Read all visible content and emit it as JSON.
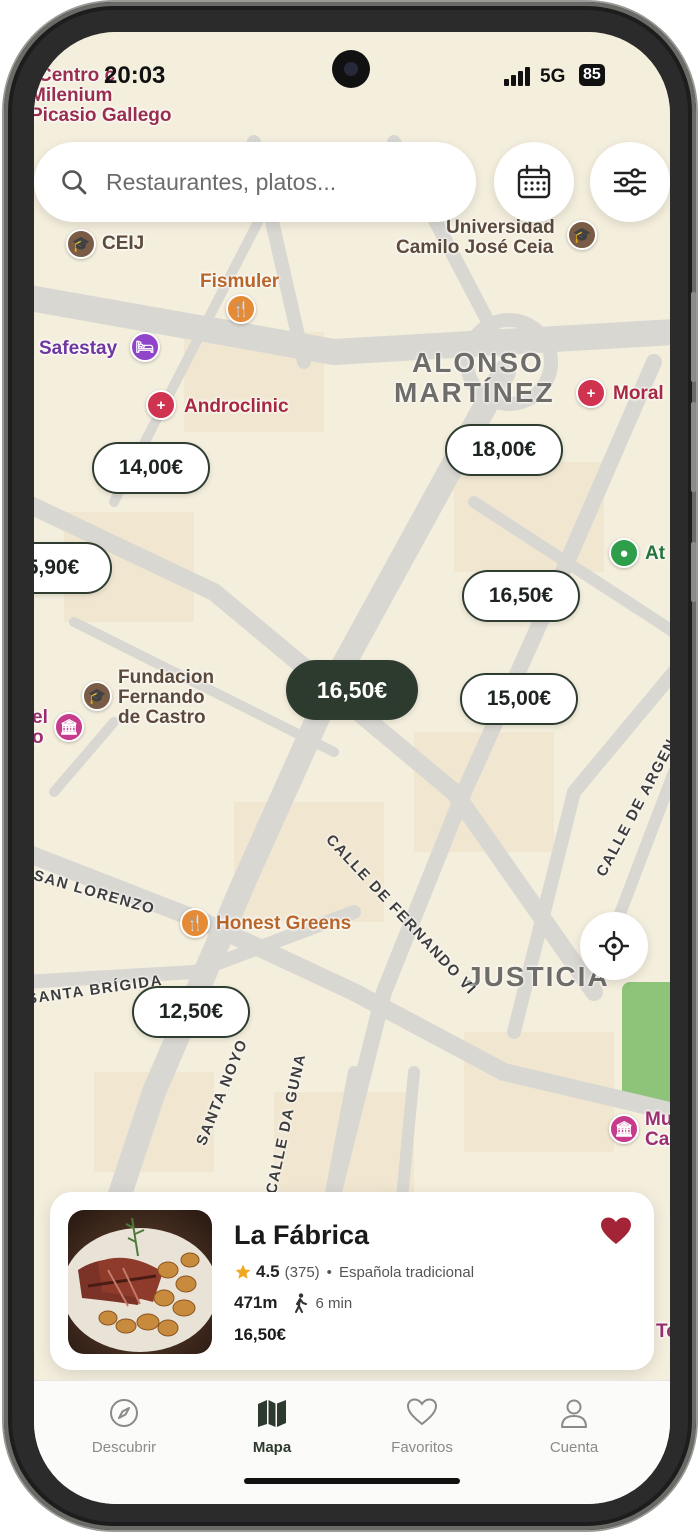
{
  "status_bar": {
    "time": "20:03",
    "network": "5G",
    "battery": "85"
  },
  "search": {
    "placeholder": "Restaurantes, platos..."
  },
  "map": {
    "districts": [
      "ALONSO",
      "MARTÍNEZ",
      "JUSTICIA"
    ],
    "streets": [
      "CALLE DE FERNANDO VI",
      "SAN LORENZO",
      "SANTA BRÍGIDA",
      "SANTA NOYO",
      "CALLE DA GUNA",
      "CALLE DE ARGEN"
    ],
    "pois": [
      {
        "label": "Centro c",
        "icon": "none"
      },
      {
        "label": "Milenium",
        "icon": "none"
      },
      {
        "label": "Picasio Gallego",
        "icon": "none"
      },
      {
        "label": "CEIJ",
        "icon": "education-icon",
        "color": "#7a5b45"
      },
      {
        "label": "Universidad",
        "icon": "none"
      },
      {
        "label": "Camilo José Ceia",
        "icon": "education-icon",
        "color": "#7a5b45"
      },
      {
        "label": "Fismuler",
        "icon": "restaurant-icon",
        "color": "#e58a35"
      },
      {
        "label": "Safestay",
        "icon": "hotel-icon",
        "color": "#8f44c9"
      },
      {
        "label": "Androclinic",
        "icon": "medical-icon",
        "color": "#d0334f"
      },
      {
        "label": "Moral",
        "icon": "medical-icon",
        "color": "#d0334f"
      },
      {
        "label": "At",
        "icon": "place-icon",
        "color": "#2e9e4a"
      },
      {
        "label": "Fundacion",
        "icon": "none"
      },
      {
        "label": "Fernando",
        "icon": "none"
      },
      {
        "label": "de Castro",
        "icon": "education-icon",
        "color": "#7a5b45"
      },
      {
        "label": "el",
        "icon": "none"
      },
      {
        "label": "o",
        "icon": "museum-icon",
        "color": "#c63b8c"
      },
      {
        "label": "Honest Greens",
        "icon": "restaurant-icon",
        "color": "#e58a35"
      },
      {
        "label": "Mu",
        "icon": "museum-icon",
        "color": "#c63b8c"
      },
      {
        "label": "Ca",
        "icon": "none"
      },
      {
        "label": "Te",
        "icon": "none"
      }
    ],
    "price_markers": [
      "14,00€",
      "18,00€",
      "5,90€",
      "16,50€",
      "16,50€",
      "15,00€",
      "12,50€"
    ]
  },
  "card": {
    "name": "La Fábrica",
    "rating": "4.5",
    "reviews": "(375)",
    "separator": "•",
    "cuisine": "Española tradicional",
    "distance": "471m",
    "walk_time": "6 min",
    "price": "16,50€",
    "favorite": true,
    "heart_color": "#a32436"
  },
  "tabs": [
    {
      "label": "Descubrir",
      "icon": "compass-icon",
      "active": false
    },
    {
      "label": "Mapa",
      "icon": "map-icon",
      "active": true
    },
    {
      "label": "Favoritos",
      "icon": "heart-outline-icon",
      "active": false
    },
    {
      "label": "Cuenta",
      "icon": "user-icon",
      "active": false
    }
  ],
  "colors": {
    "accent": "#2c3b2e",
    "map_bg": "#f4eedd",
    "road": "#d6d4cf"
  }
}
